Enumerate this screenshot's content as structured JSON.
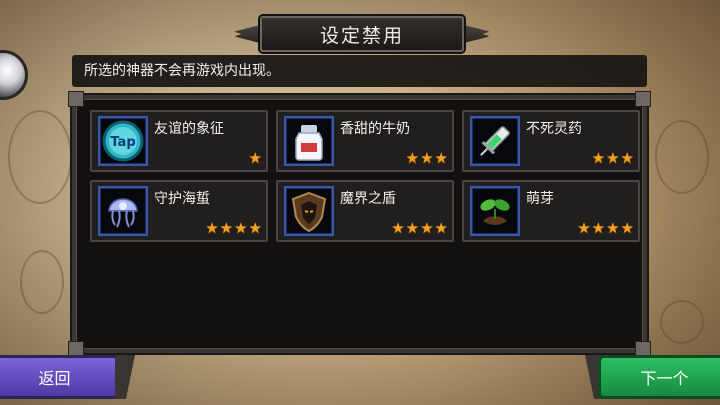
{
  "title": "设定禁用",
  "description": "所选的神器不会再游戏内出现。",
  "artifacts": [
    {
      "name": "友谊的象征",
      "stars": 1,
      "icon": "tap-token-icon"
    },
    {
      "name": "香甜的牛奶",
      "stars": 3,
      "icon": "milk-bottle-icon"
    },
    {
      "name": "不死灵药",
      "stars": 3,
      "icon": "syringe-icon"
    },
    {
      "name": "守护海蜇",
      "stars": 4,
      "icon": "jellyfish-icon"
    },
    {
      "name": "魔界之盾",
      "stars": 4,
      "icon": "demon-shield-icon"
    },
    {
      "name": "萌芽",
      "stars": 4,
      "icon": "sprout-icon"
    }
  ],
  "buttons": {
    "back": "返回",
    "next": "下一个"
  },
  "colors": {
    "star": "#f3a21f",
    "back_button": "#6a52c8",
    "next_button": "#22a350",
    "icon_border": "#3a58a8"
  }
}
